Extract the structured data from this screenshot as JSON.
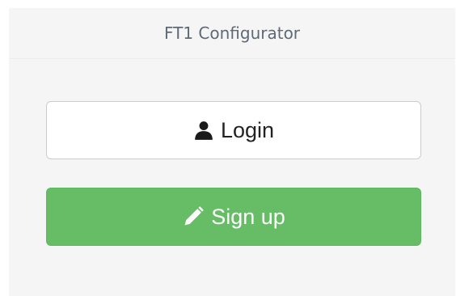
{
  "panel": {
    "title": "FT1 Configurator"
  },
  "buttons": {
    "login": {
      "label": "Login",
      "icon": "user-icon"
    },
    "signup": {
      "label": "Sign up",
      "icon": "pencil-icon"
    }
  },
  "colors": {
    "panel_bg": "#f5f5f5",
    "title_text": "#5e6a78",
    "login_bg": "#ffffff",
    "login_border": "#cccccc",
    "signup_bg": "#66bd66",
    "signup_text": "#ffffff"
  }
}
